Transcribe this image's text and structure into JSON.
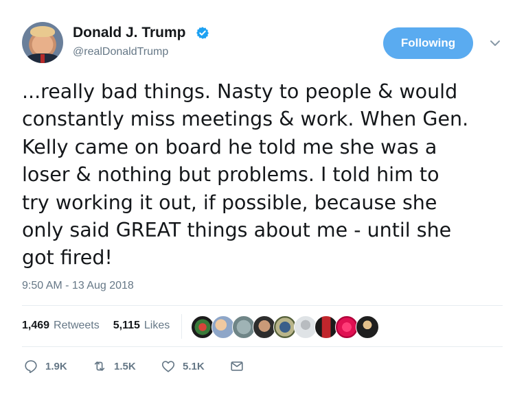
{
  "author": {
    "name": "Donald J. Trump",
    "handle": "@realDonaldTrump",
    "verified": true
  },
  "follow_button": {
    "label": "Following"
  },
  "tweet": {
    "lines": [
      "...really bad things. Nasty to people & would",
      "constantly miss meetings & work. When Gen.",
      "Kelly came on board he told me she was a",
      "loser & nothing but problems. I told him to",
      "try working it out, if possible, because she",
      "only said GREAT things about me - until she",
      "got fired!"
    ],
    "timestamp": "9:50 AM - 13 Aug 2018"
  },
  "stats": {
    "retweets_count": "1,469",
    "retweets_label": "Retweets",
    "likes_count": "5,115",
    "likes_label": "Likes"
  },
  "actions": {
    "reply_count": "1.9K",
    "retweet_count": "1.5K",
    "like_count": "5.1K"
  },
  "colors": {
    "accent": "#5aabf0",
    "muted": "#657786",
    "text": "#14171a",
    "divider": "#e6ecf0"
  },
  "icons": [
    "verified-badge-icon",
    "chevron-down-icon",
    "reply-icon",
    "retweet-icon",
    "heart-icon",
    "envelope-icon"
  ]
}
